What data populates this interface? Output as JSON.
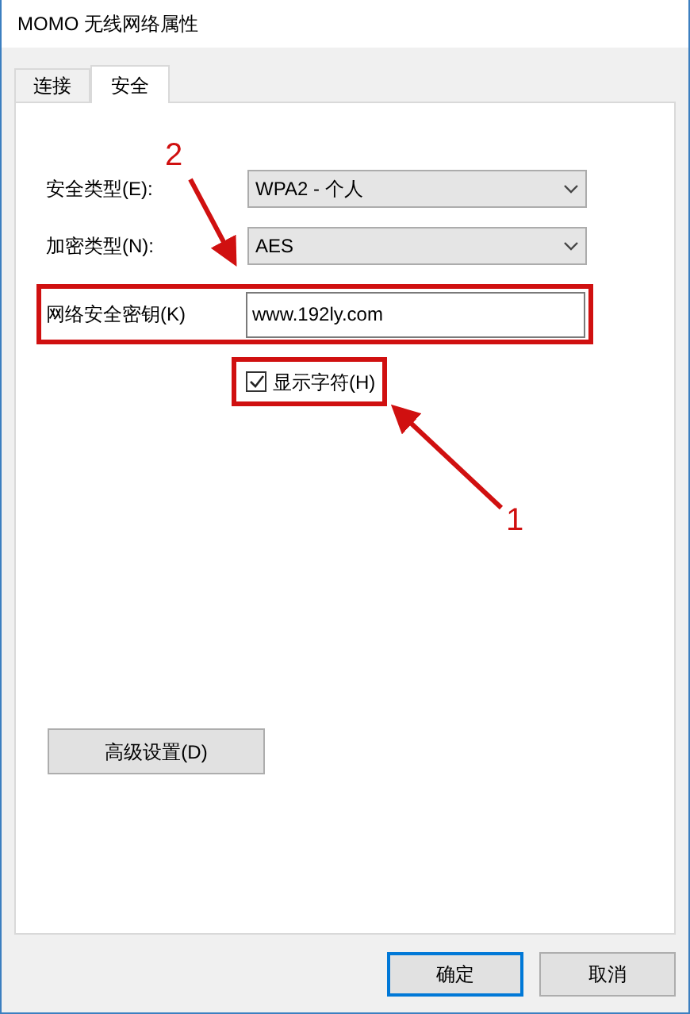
{
  "window": {
    "title": "MOMO 无线网络属性"
  },
  "tabs": [
    {
      "label": "连接",
      "selected": false
    },
    {
      "label": "安全",
      "selected": true
    }
  ],
  "fields": [
    {
      "kind": "dropdown",
      "label": "安全类型(E):",
      "value": "WPA2 - 个人",
      "highlighted": false
    },
    {
      "kind": "dropdown",
      "label": "加密类型(N):",
      "value": "AES",
      "highlighted": false
    },
    {
      "kind": "text",
      "label": "网络安全密钥(K)",
      "value": "www.192ly.com",
      "highlighted": true
    }
  ],
  "show_characters": {
    "label": "显示字符(H)",
    "checked": true,
    "highlighted": true
  },
  "advanced_button": "高级设置(D)",
  "buttons": [
    {
      "label": "确定",
      "default": true
    },
    {
      "label": "取消",
      "default": false
    }
  ],
  "annotations": [
    {
      "label": "2"
    },
    {
      "label": "1"
    }
  ]
}
